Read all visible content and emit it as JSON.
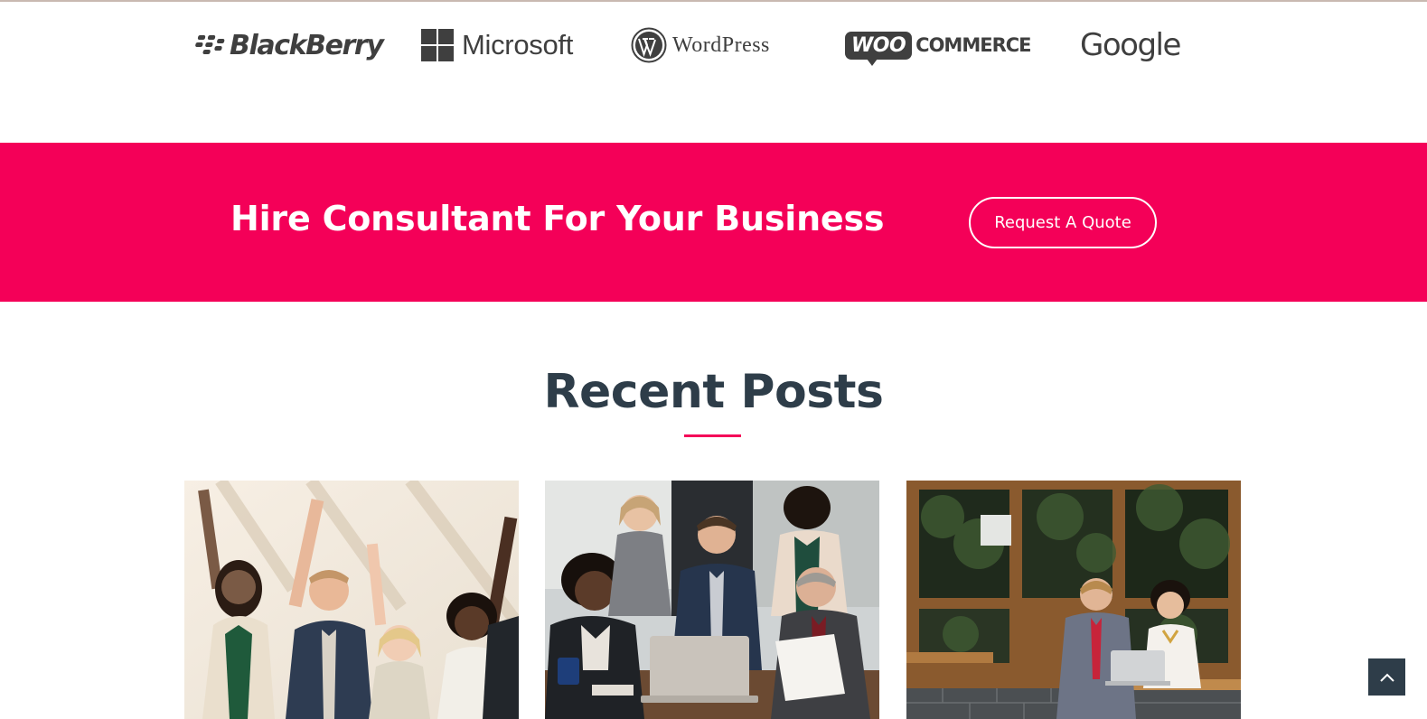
{
  "partners": {
    "logos": [
      {
        "name": "BlackBerry",
        "icon": "blackberry-logo"
      },
      {
        "name": "Microsoft",
        "icon": "microsoft-logo"
      },
      {
        "name": "WordPress",
        "icon": "wordpress-logo"
      },
      {
        "name": "WooCommerce",
        "badge": "WOO",
        "word": "COMMERCE",
        "icon": "woocommerce-logo"
      },
      {
        "name": "Google",
        "icon": "google-logo"
      }
    ]
  },
  "cta": {
    "title": "Hire Consultant For Your Business",
    "button_label": "Request A Quote",
    "background": "#f40058"
  },
  "recent_posts": {
    "title": "Recent Posts",
    "accent": "#f40058",
    "posts": [
      {
        "image": "team-celebrating-photo"
      },
      {
        "image": "business-meeting-laptop-photo"
      },
      {
        "image": "cafe-meeting-photo"
      }
    ]
  },
  "scroll_top": {
    "icon": "chevron-up-icon",
    "background": "#2e3d49"
  }
}
